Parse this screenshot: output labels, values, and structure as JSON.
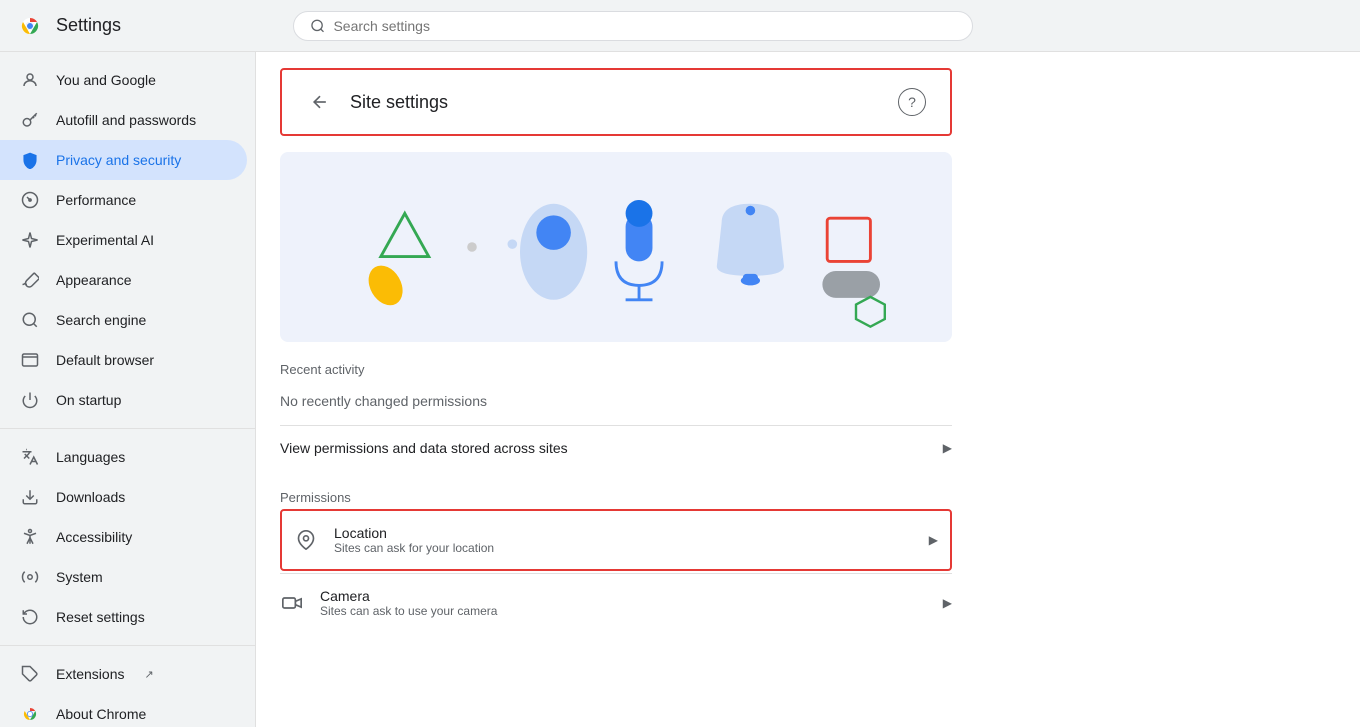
{
  "topbar": {
    "title": "Settings",
    "search_placeholder": "Search settings"
  },
  "sidebar": {
    "items": [
      {
        "id": "you-and-google",
        "label": "You and Google",
        "icon": "person-icon",
        "active": false
      },
      {
        "id": "autofill",
        "label": "Autofill and passwords",
        "icon": "key-icon",
        "active": false
      },
      {
        "id": "privacy-security",
        "label": "Privacy and security",
        "icon": "shield-icon",
        "active": true
      },
      {
        "id": "performance",
        "label": "Performance",
        "icon": "gauge-icon",
        "active": false
      },
      {
        "id": "experimental-ai",
        "label": "Experimental AI",
        "icon": "sparkle-icon",
        "active": false
      },
      {
        "id": "appearance",
        "label": "Appearance",
        "icon": "brush-icon",
        "active": false
      },
      {
        "id": "search-engine",
        "label": "Search engine",
        "icon": "search-icon",
        "active": false
      },
      {
        "id": "default-browser",
        "label": "Default browser",
        "icon": "browser-icon",
        "active": false
      },
      {
        "id": "on-startup",
        "label": "On startup",
        "icon": "power-icon",
        "active": false
      },
      {
        "id": "languages",
        "label": "Languages",
        "icon": "translate-icon",
        "active": false
      },
      {
        "id": "downloads",
        "label": "Downloads",
        "icon": "download-icon",
        "active": false
      },
      {
        "id": "accessibility",
        "label": "Accessibility",
        "icon": "accessibility-icon",
        "active": false
      },
      {
        "id": "system",
        "label": "System",
        "icon": "system-icon",
        "active": false
      },
      {
        "id": "reset-settings",
        "label": "Reset settings",
        "icon": "reset-icon",
        "active": false
      },
      {
        "id": "extensions",
        "label": "Extensions",
        "icon": "puzzle-icon",
        "active": false
      },
      {
        "id": "about-chrome",
        "label": "About Chrome",
        "icon": "chrome-icon",
        "active": false
      }
    ]
  },
  "content": {
    "site_settings_title": "Site settings",
    "back_label": "←",
    "recent_activity_label": "Recent activity",
    "no_activity_text": "No recently changed permissions",
    "view_permissions_text": "View permissions and data stored across sites",
    "permissions_label": "Permissions",
    "permissions": [
      {
        "id": "location",
        "name": "Location",
        "desc": "Sites can ask for your location",
        "highlighted": true
      },
      {
        "id": "camera",
        "name": "Camera",
        "desc": "Sites can ask to use your camera",
        "highlighted": false
      }
    ]
  }
}
